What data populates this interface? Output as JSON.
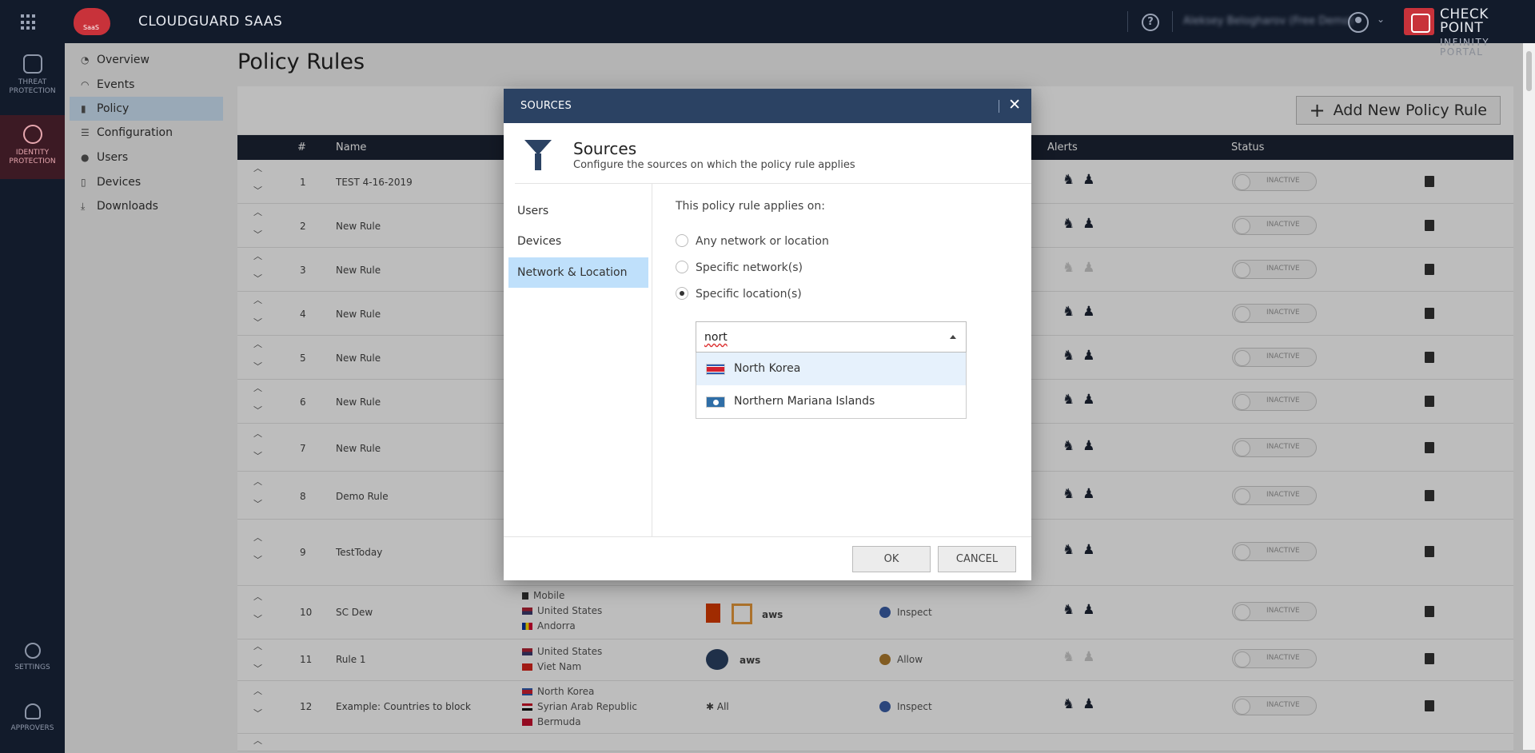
{
  "topbar": {
    "product": "CLOUDGUARD SAAS",
    "logo_text": "SaaS",
    "user": "Aleksey Belogharov (Free Demo)",
    "brand_line1": "CHECK POINT",
    "brand_line2": "INFINITY PORTAL"
  },
  "leftnav": {
    "threat": "THREAT PROTECTION",
    "identity": "IDENTITY PROTECTION",
    "settings": "SETTINGS",
    "approvers": "APPROVERS"
  },
  "subnav": {
    "items": [
      {
        "label": "Overview",
        "icon": "◔"
      },
      {
        "label": "Events",
        "icon": "◠"
      },
      {
        "label": "Policy",
        "icon": "▮"
      },
      {
        "label": "Configuration",
        "icon": "☰"
      },
      {
        "label": "Users",
        "icon": "●"
      },
      {
        "label": "Devices",
        "icon": "▯"
      },
      {
        "label": "Downloads",
        "icon": "⤓"
      }
    ]
  },
  "page": {
    "title": "Policy Rules",
    "add_button": "Add New Policy Rule",
    "add_icon": "+",
    "columns": {
      "num": "#",
      "name": "Name",
      "alerts": "Alerts",
      "status": "Status"
    }
  },
  "rows": [
    {
      "num": "1",
      "name": "TEST 4-16-2019",
      "status": "INACTIVE",
      "alert_icons": "♞♟",
      "dim": false
    },
    {
      "num": "2",
      "name": "New Rule",
      "status": "INACTIVE",
      "alert_icons": "♞♟",
      "dim": false
    },
    {
      "num": "3",
      "name": "New Rule",
      "status": "INACTIVE",
      "alert_icons": "♞♟",
      "dim": true
    },
    {
      "num": "4",
      "name": "New Rule",
      "status": "INACTIVE",
      "alert_icons": "♞♟",
      "dim": false
    },
    {
      "num": "5",
      "name": "New Rule",
      "status": "INACTIVE",
      "alert_icons": "♞♟",
      "dim": false
    },
    {
      "num": "6",
      "name": "New Rule",
      "status": "INACTIVE",
      "alert_icons": "♞♟",
      "dim": false
    },
    {
      "num": "7",
      "name": "New Rule",
      "status": "INACTIVE",
      "alert_icons": "♞♟",
      "dim": false
    },
    {
      "num": "8",
      "name": "Demo Rule",
      "status": "INACTIVE",
      "alert_icons": "♞♟",
      "dim": false
    },
    {
      "num": "9",
      "name": "TestToday",
      "status": "INACTIVE",
      "alert_icons": "♞♟",
      "dim": false
    },
    {
      "num": "10",
      "name": "SC Dew",
      "status": "INACTIVE",
      "sources": [
        "Mobile",
        "United States",
        "Andorra"
      ],
      "apps": "aws",
      "action": "Inspect",
      "alert_icons": "♞♟",
      "dim": false
    },
    {
      "num": "11",
      "name": "Rule 1",
      "status": "INACTIVE",
      "sources": [
        "United States",
        "Viet Nam"
      ],
      "apps": "aws",
      "action": "Allow",
      "alert_icons": "♞♟",
      "dim": true
    },
    {
      "num": "12",
      "name": "Example: Countries to block",
      "status": "INACTIVE",
      "sources": [
        "North Korea",
        "Syrian Arab Republic",
        "Bermuda"
      ],
      "apps": "✱ All",
      "action": "Inspect",
      "alert_icons": "♞♟",
      "dim": false
    }
  ],
  "modal": {
    "header": "SOURCES",
    "close": "✕",
    "heading": "Sources",
    "subheading": "Configure the sources on which the policy rule applies",
    "tabs": [
      "Users",
      "Devices",
      "Network & Location"
    ],
    "applies_label": "This policy rule applies on:",
    "options": [
      "Any network or location",
      "Specific network(s)",
      "Specific location(s)"
    ],
    "search_value": "nort",
    "results": [
      "North Korea",
      "Northern Mariana Islands"
    ],
    "ok": "OK",
    "cancel": "CANCEL"
  }
}
